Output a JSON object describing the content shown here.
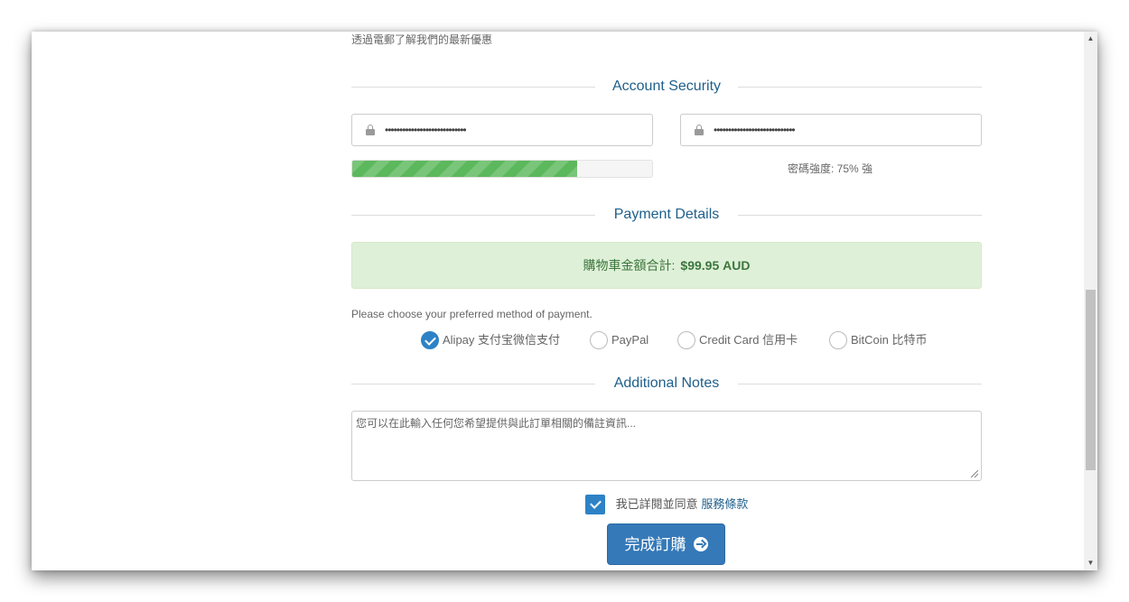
{
  "promo": {
    "text": "透過電郵了解我們的最新優惠"
  },
  "account_security": {
    "title": "Account Security",
    "password_value": "••••••••••••••••••••••••••••",
    "confirm_password_value": "••••••••••••••••••••••••••••",
    "strength_percent": 75,
    "strength_label": "密碼強度: 75% 強",
    "strength_color": "#5cb85c"
  },
  "payment_details": {
    "title": "Payment Details",
    "cart_label": "購物車金額合計:",
    "cart_amount": "$99.95 AUD",
    "prompt": "Please choose your preferred method of payment.",
    "methods": [
      {
        "label": "Alipay 支付宝微信支付",
        "selected": true
      },
      {
        "label": "PayPal",
        "selected": false
      },
      {
        "label": "Credit Card 信用卡",
        "selected": false
      },
      {
        "label": "BitCoin 比特币",
        "selected": false
      }
    ]
  },
  "additional_notes": {
    "title": "Additional Notes",
    "placeholder": "您可以在此輸入任何您希望提供與此訂單相關的備註資訊..."
  },
  "agreement": {
    "checked": true,
    "text": "我已詳閱並同意",
    "link_text": "服務條款"
  },
  "submit": {
    "label": "完成訂購"
  },
  "colors": {
    "accent": "#3579b8",
    "heading": "#1f5f8b",
    "success_bg": "#dff0d8"
  }
}
